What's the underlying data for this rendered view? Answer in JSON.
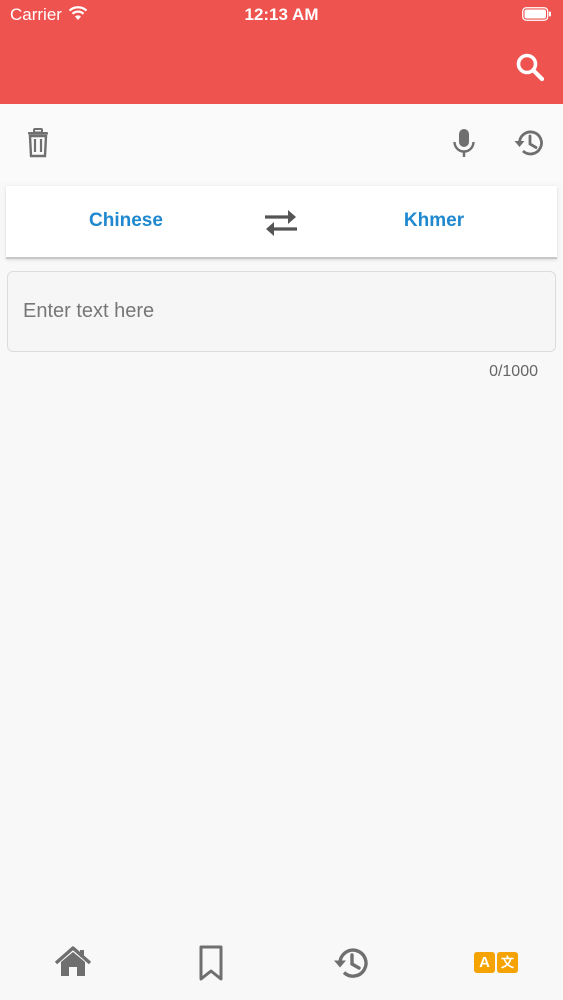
{
  "status_bar": {
    "carrier": "Carrier",
    "time": "12:13 AM"
  },
  "app_bar": {
    "color": "#ef5350",
    "search_icon": "search-icon"
  },
  "toolbar": {
    "left": [
      "trash-icon"
    ],
    "right": [
      "microphone-icon",
      "history-icon"
    ]
  },
  "languages": {
    "source": "Chinese",
    "target": "Khmer",
    "swap_icon": "swap-arrows-icon",
    "accent": "#1f88cf"
  },
  "input": {
    "value": "",
    "placeholder": "Enter text here",
    "counter": "0/1000"
  },
  "bottom_nav": {
    "items": [
      {
        "icon": "home-icon",
        "active": false
      },
      {
        "icon": "bookmark-icon",
        "active": false
      },
      {
        "icon": "history-icon",
        "active": false
      },
      {
        "icon": "translate-icon",
        "active": true,
        "glyphs": [
          "A",
          "文"
        ]
      }
    ],
    "active_color": "#f5a300",
    "inactive_color": "#6f6f6f"
  }
}
